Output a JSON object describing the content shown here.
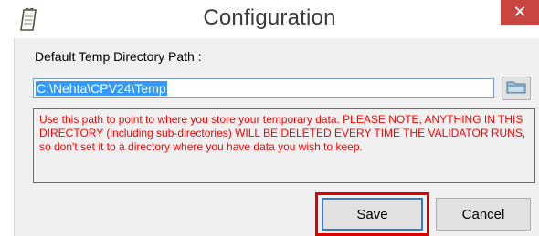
{
  "window": {
    "title": "Configuration",
    "close_glyph": "✕",
    "icon": "notepad-icon"
  },
  "form": {
    "directory_label": "Default Temp Directory Path :",
    "path_value": "C:\\Nehta\\CPV24\\Temp",
    "browse_icon": "folder-icon",
    "warning_text": "Use this path to point to where you store your temporary data. PLEASE NOTE, ANYTHING IN THIS DIRECTORY (including sub-directories) WILL BE DELETED EVERY TIME THE VALIDATOR RUNS, so don't set it to a directory where you have data you wish to keep.",
    "warning_color": "#ff0000"
  },
  "buttons": {
    "save_label": "Save",
    "cancel_label": "Cancel",
    "highlight_color": "#e00000"
  }
}
